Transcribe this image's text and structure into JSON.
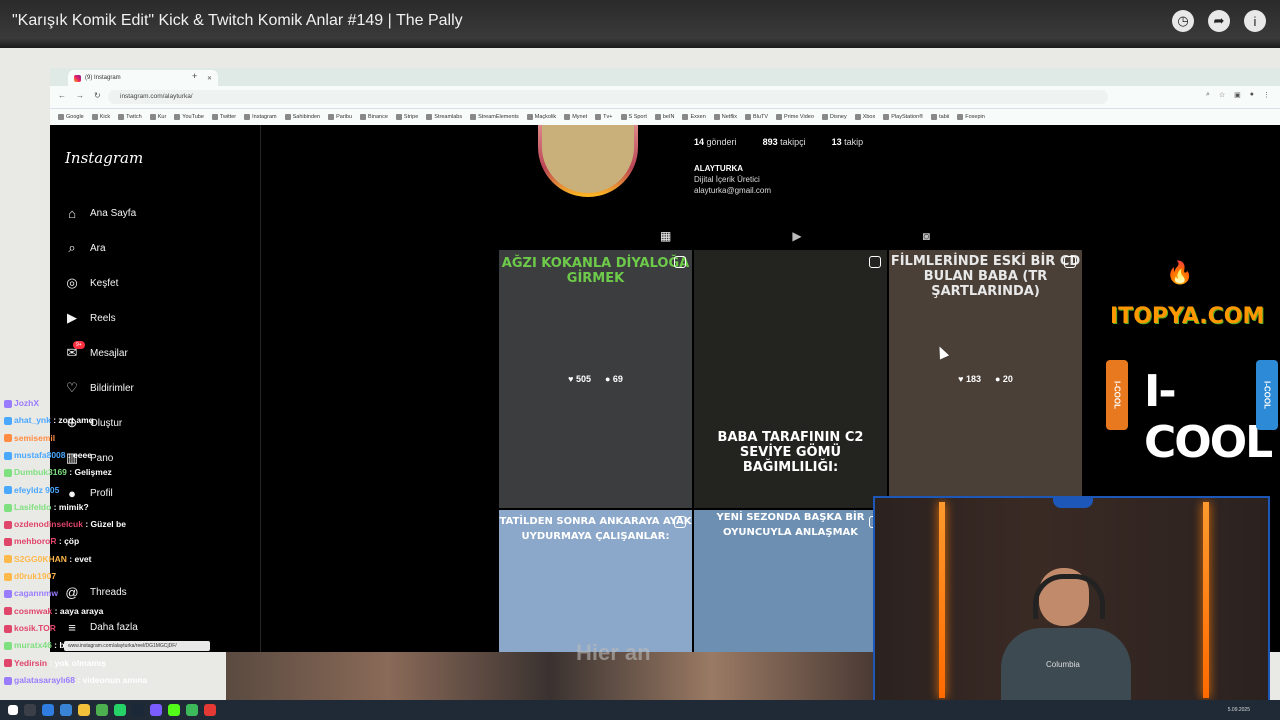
{
  "video": {
    "title": "\"Karışık Komik Edit\" Kick & Twitch Komik Anlar #149 | The Pally",
    "icons": [
      "clock-icon",
      "share-icon",
      "info-icon"
    ]
  },
  "browser": {
    "tab_title": "(9) Instagram",
    "url": "instagram.com/alayturka/",
    "bookmarks": [
      "Google",
      "Kick",
      "Twitch",
      "Kur",
      "YouTube",
      "Twitter",
      "Instagram",
      "Sahibinden",
      "Paribu",
      "Binance",
      "Stripe",
      "Streamlabs",
      "StreamElements",
      "Maçkolik",
      "Mynet",
      "Tv+",
      "S Sport",
      "beIN",
      "Exxen",
      "Netflix",
      "BluTV",
      "Prime Video",
      "Disney",
      "Xbox",
      "PlayStation®",
      "tabii",
      "Foxepin"
    ],
    "hover_link": "www.instagram.com/alayturka/reel/DG1MGCjDF/"
  },
  "instagram": {
    "logo": "Instagram",
    "nav": [
      {
        "label": "Ana Sayfa",
        "icon": "home-icon"
      },
      {
        "label": "Ara",
        "icon": "search-icon"
      },
      {
        "label": "Keşfet",
        "icon": "compass-icon"
      },
      {
        "label": "Reels",
        "icon": "reels-icon"
      },
      {
        "label": "Mesajlar",
        "icon": "messenger-icon",
        "badge": "9+"
      },
      {
        "label": "Bildirimler",
        "icon": "heart-icon"
      },
      {
        "label": "Oluştur",
        "icon": "plus-icon"
      },
      {
        "label": "Pano",
        "icon": "dashboard-icon"
      },
      {
        "label": "Profil",
        "icon": "avatar-icon"
      },
      {
        "label": "Threads",
        "icon": "threads-icon"
      },
      {
        "label": "Daha fazla",
        "icon": "menu-icon"
      }
    ],
    "profile": {
      "posts": "14",
      "posts_label": "gönderi",
      "followers": "893",
      "followers_label": "takipçi",
      "following": "13",
      "following_label": "takip",
      "name": "ALAYTURKA",
      "category": "Dijital İçerik Üretici",
      "email": "alayturka@gmail.com"
    },
    "tabs": [
      "grid-icon",
      "reels-icon",
      "tagged-icon"
    ],
    "posts": [
      {
        "caption": "AĞZI KOKANLA DİYALOĞA GİRMEK",
        "likes": "505",
        "comments": "69",
        "bg": "#3b3d3f",
        "capcolor": "#6ecb4a"
      },
      {
        "caption": "BABA TARAFININ C2 SEVİYE GÖMÜ BAĞIMLILIĞI:",
        "likes": "",
        "comments": "",
        "bg": "#23231f",
        "capcolor": "#ffffff"
      },
      {
        "caption": "FİLMLERİNDE ESKİ BİR CD BULAN BABA (TR ŞARTLARINDA)",
        "likes": "183",
        "comments": "20",
        "bg": "#4a4038",
        "capcolor": "#e8e8e8"
      },
      {
        "caption": "TATİLDEN SONRA ANKARAYA AYAK UYDURMAYA ÇALIŞANLAR:",
        "likes": "",
        "comments": "",
        "bg": "#8ba7c9",
        "capcolor": "#ffffff"
      },
      {
        "caption": "YENİ SEZONDA BAŞKA BİR OYUNCUYLA ANLAŞMAK",
        "likes": "",
        "comments": "",
        "bg": "#6d8fb2",
        "capcolor": "#ffffff"
      }
    ]
  },
  "ads": {
    "itopya": "ITOPYA.COM",
    "icool": "I-COOL",
    "can_text": "I-COOL"
  },
  "chat": [
    {
      "user": "JozhX",
      "msg": "",
      "color": "#9a7cff"
    },
    {
      "user": "ahat_ynk",
      "msg": "zort amq",
      "color": "#4aa8ff"
    },
    {
      "user": "semisemil",
      "msg": "",
      "color": "#ff8c42"
    },
    {
      "user": "mustafa8008",
      "msg": "eeee",
      "color": "#4aa8ff"
    },
    {
      "user": "Dumbuk3169",
      "msg": "Gelişmez",
      "color": "#7fe07f"
    },
    {
      "user": "efeyldz 905",
      "msg": "",
      "color": "#4aa8ff"
    },
    {
      "user": "Lasifeldo",
      "msg": "mimik?",
      "color": "#7fe07f"
    },
    {
      "user": "ozdenodinselcuk",
      "msg": "Güzel be",
      "color": "#e0456a"
    },
    {
      "user": "mehboroR",
      "msg": "çöp",
      "color": "#e0456a"
    },
    {
      "user": "S2GG0KHAN",
      "msg": "evet",
      "color": "#ffb84a"
    },
    {
      "user": "d0ruk1907",
      "msg": "",
      "color": "#ffb84a"
    },
    {
      "user": "cagannmw",
      "msg": "",
      "color": "#9a7cff"
    },
    {
      "user": "cosmwak",
      "msg": "aaya araya",
      "color": "#e0456a"
    },
    {
      "user": "kosik.TOR",
      "msg": "",
      "color": "#e0456a"
    },
    {
      "user": "muratx46",
      "msg": "bune",
      "color": "#7fe07f"
    },
    {
      "user": "Yedirsin",
      "msg": "yok olmamış",
      "color": "#e0456a"
    },
    {
      "user": "galatasaraylı68",
      "msg": "videonun amına",
      "color": "#9a7cff"
    }
  ],
  "stream": {
    "shirt_brand": "Columbia",
    "overlay_text": "Hier an",
    "clock": "5.09.2025"
  }
}
